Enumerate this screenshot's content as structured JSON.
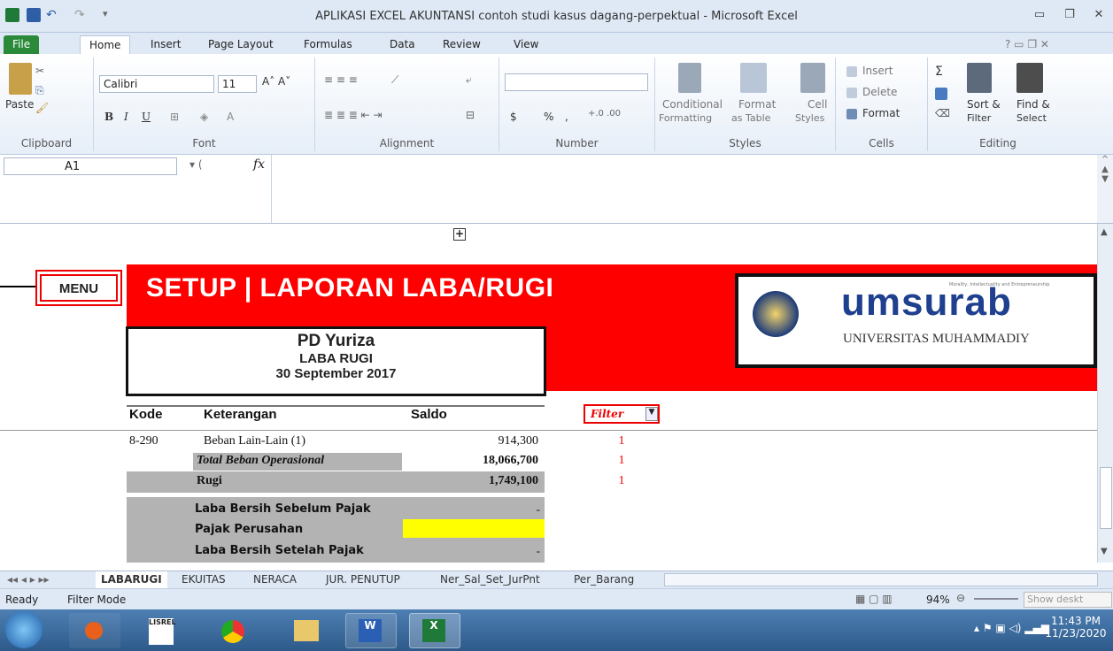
{
  "window": {
    "title": "APLIKASI EXCEL AKUNTANSI contoh studi kasus dagang-perpektual - Microsoft Excel"
  },
  "ribbon_tabs": [
    "File",
    "Home",
    "Insert",
    "Page Layout",
    "Formulas",
    "Data",
    "Review",
    "View"
  ],
  "ribbon": {
    "clipboard": {
      "paste": "Paste",
      "label": "Clipboard"
    },
    "font": {
      "name": "Calibri",
      "size": "11",
      "label": "Font"
    },
    "alignment": {
      "label": "Alignment"
    },
    "number": {
      "format": "",
      "label": "Number",
      "currency": "$",
      "percent": "%",
      "comma": ","
    },
    "styles": {
      "conditional": "Conditional",
      "conditional2": "Formatting",
      "format_table": "Format",
      "format_table2": "as Table",
      "cell_styles": "Cell",
      "cell_styles2": "Styles",
      "label": "Styles"
    },
    "cells": {
      "insert": "Insert",
      "delete": "Delete",
      "format": "Format",
      "label": "Cells"
    },
    "editing": {
      "sort": "Sort &",
      "sort2": "Filter",
      "find": "Find &",
      "find2": "Select",
      "label": "Editing"
    }
  },
  "formula_bar": {
    "name_box": "A1",
    "fx": "fx",
    "content": ""
  },
  "sheet": {
    "menu_label": "MENU",
    "title": "SETUP | LAPORAN LABA/RUGI",
    "company": "PD Yuriza",
    "report": "LABA RUGI",
    "date": "30 September 2017",
    "logo_text": "umsurab",
    "logo_sub": "UNIVERSITAS MUHAMMADIY",
    "logo_tiny": "Morality, Intellectuality and Entrepreneurship",
    "headers": {
      "kode": "Kode",
      "ket": "Keterangan",
      "saldo": "Saldo",
      "filter": "Filter"
    },
    "rows": [
      {
        "kode": "8-290",
        "ket": "Beban Lain-Lain (1)",
        "saldo": "914,300",
        "filter": "1"
      },
      {
        "kode": "",
        "ket": "Total Beban Operasional",
        "saldo": "18,066,700",
        "filter": "1"
      },
      {
        "kode": "",
        "ket": "Rugi",
        "saldo": "1,749,100",
        "filter": "1"
      }
    ],
    "summary": [
      {
        "label": "Laba Bersih Sebelum Pajak",
        "value": "-"
      },
      {
        "label": "Pajak Perusahan",
        "value": ""
      },
      {
        "label": "Laba Bersih Setelah Pajak",
        "value": "-"
      }
    ]
  },
  "sheet_tabs": [
    "LABARUGI",
    "EKUITAS",
    "NERACA",
    "JUR. PENUTUP",
    "Ner_Sal_Set_JurPnt",
    "Per_Barang"
  ],
  "status": {
    "ready": "Ready",
    "mode": "Filter Mode",
    "zoom": "94%",
    "show_desktop": "Show deskt"
  },
  "taskbar": {
    "time": "11:43 PM",
    "date": "11/23/2020",
    "lisrel": "LISREL"
  },
  "colors": {
    "banner": "#ff0000",
    "highlight": "#ffff00",
    "file_tab": "#2a8a3a"
  }
}
